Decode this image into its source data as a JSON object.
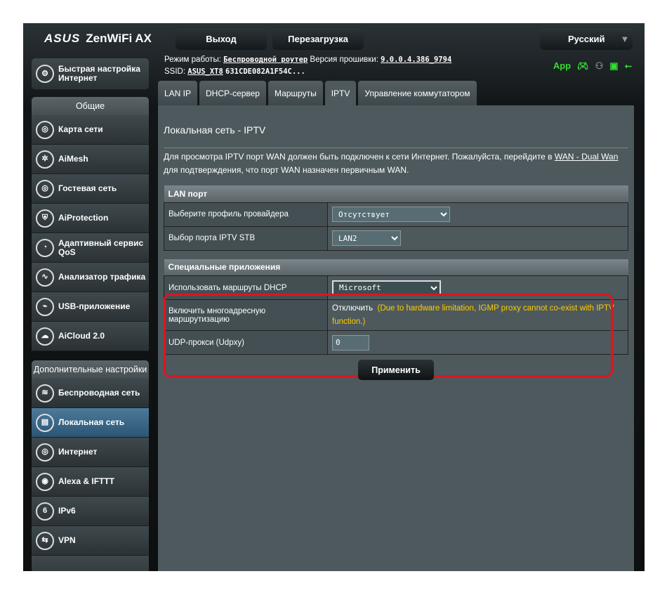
{
  "header": {
    "brand": "ASUS",
    "model": "ZenWiFi AX",
    "logout": "Выход",
    "reboot": "Перезагрузка",
    "language": "Русский"
  },
  "info": {
    "mode_label": "Режим работы:",
    "mode": "Беспроводной роутер",
    "fw_label": "Версия прошивки:",
    "fw": "9.0.0.4.386_9794",
    "ssid_label": "SSID:",
    "ssid": "ASUS_XT8",
    "ssid2": "631CDE082A1F54C...",
    "app": "App"
  },
  "sidebar": {
    "quick": "Быстрая настройка Интернет",
    "general": "Общие",
    "items": [
      "Карта сети",
      "AiMesh",
      "Гостевая сеть",
      "AiProtection",
      "Адаптивный сервис QoS",
      "Анализатор трафика",
      "USB-приложение",
      "AiCloud 2.0"
    ],
    "advanced": "Дополнительные настройки",
    "adv_items": [
      "Беспроводная сеть",
      "Локальная сеть",
      "Интернет",
      "Alexa & IFTTT",
      "IPv6",
      "VPN"
    ]
  },
  "tabs": [
    "LAN IP",
    "DHCP-сервер",
    "Маршруты",
    "IPTV",
    "Управление коммутатором"
  ],
  "page": {
    "title": "Локальная сеть - IPTV",
    "desc1": "Для просмотра IPTV порт WAN должен быть подключен к сети Интернет. Пожалуйста, перейдите в ",
    "desc_link": "WAN - Dual Wan",
    "desc2": " для подтверждения, что порт WAN назначен первичным WAN."
  },
  "lan": {
    "header": "LAN порт",
    "profile_label": "Выберите профиль провайдера",
    "profile": "Отсутствует",
    "stb_label": "Выбор порта IPTV STB",
    "stb": "LAN2"
  },
  "special": {
    "header": "Специальные приложения",
    "dhcp_label": "Использовать маршруты DHCP",
    "dhcp": "Microsoft",
    "mcast_label": "Включить многоадресную маршрутизацию",
    "mcast": "Отключить",
    "mcast_note": "(Due to hardware limitation, IGMP proxy cannot co-exist with IPTV function.)",
    "udp_label": "UDP-прокси (Udpxy)",
    "udp": "0"
  },
  "apply": "Применить"
}
